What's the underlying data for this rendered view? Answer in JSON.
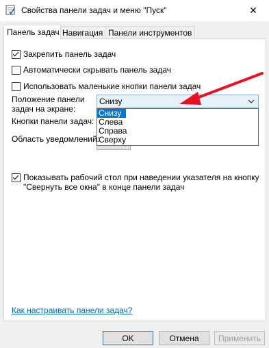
{
  "window": {
    "title": "Свойства панели задач и меню \"Пуск\"",
    "close_glyph": "✕"
  },
  "tabs": [
    {
      "label": "Панель задач",
      "active": true
    },
    {
      "label": "Навигация",
      "active": false
    },
    {
      "label": "Панели инструментов",
      "active": false
    }
  ],
  "options": {
    "lock_taskbar": {
      "label": "Закрепить панель задач",
      "checked": true
    },
    "autohide": {
      "label": "Автоматически скрывать панель задач",
      "checked": false
    },
    "small_buttons": {
      "label": "Использовать маленькие кнопки панели задач",
      "checked": false
    },
    "show_desktop": {
      "label_line1": "Показывать рабочий стол при наведении указателя на кнопку",
      "label_line2": "\"Свернуть все окна\" в конце панели задач",
      "checked": true
    }
  },
  "position": {
    "label_line1": "Положение панели",
    "label_line2": "задач на экране:",
    "selected": "Снизу",
    "items": [
      "Снизу",
      "Слева",
      "Справа",
      "Сверху"
    ]
  },
  "buttons_label": "Кнопки панели задач:",
  "notify_label": "Область уведомлений:",
  "help_link": "Как настраивать панели задач?",
  "footer": {
    "ok": "OK",
    "cancel": "Отмена",
    "apply": "Применить"
  },
  "colors": {
    "accent": "#0078d7",
    "arrow": "#e81123",
    "link": "#0066cc"
  },
  "icons": {
    "title_icon": "taskbar-properties-icon",
    "chevron": "chevron-down-icon",
    "arrow": "red-pointer-arrow"
  }
}
